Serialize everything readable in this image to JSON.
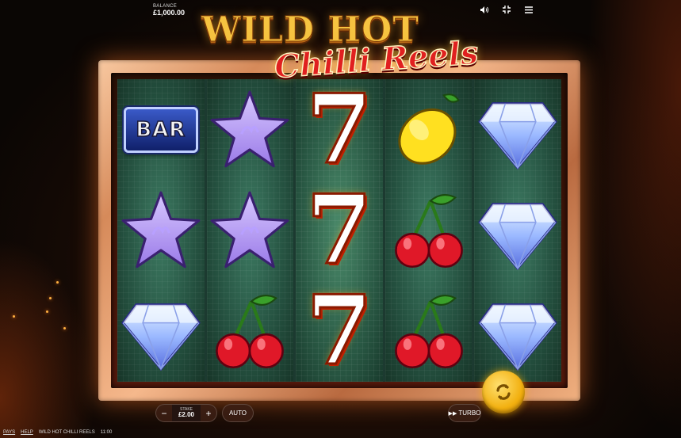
{
  "header": {
    "balance_label": "BALANCE",
    "balance_value": "£1,000.00",
    "icons": [
      "sound-icon",
      "fullscreen-icon",
      "menu-icon"
    ]
  },
  "logo": {
    "line1": "WILD HOT",
    "line2": "Chilli Reels"
  },
  "reels": [
    [
      "bar",
      "star",
      "diamond"
    ],
    [
      "star",
      "star",
      "cherry"
    ],
    [
      "seven",
      "seven",
      "seven"
    ],
    [
      "lemon",
      "cherry",
      "cherry"
    ],
    [
      "diamond",
      "diamond",
      "diamond"
    ]
  ],
  "symbols": {
    "bar_text": "BAR",
    "seven_text": "7"
  },
  "controls": {
    "stake_label": "STAKE",
    "stake_value": "£2.00",
    "minus": "−",
    "plus": "+",
    "auto": "AUTO",
    "turbo": "TURBO"
  },
  "footer": {
    "pays": "PAYS",
    "help": "HELP",
    "game_name": "WILD HOT CHILLI REELS",
    "time": "11:00"
  },
  "colors": {
    "accent": "#f2b010",
    "reel_bg": "#24503f",
    "frame": "#d68a5a"
  }
}
